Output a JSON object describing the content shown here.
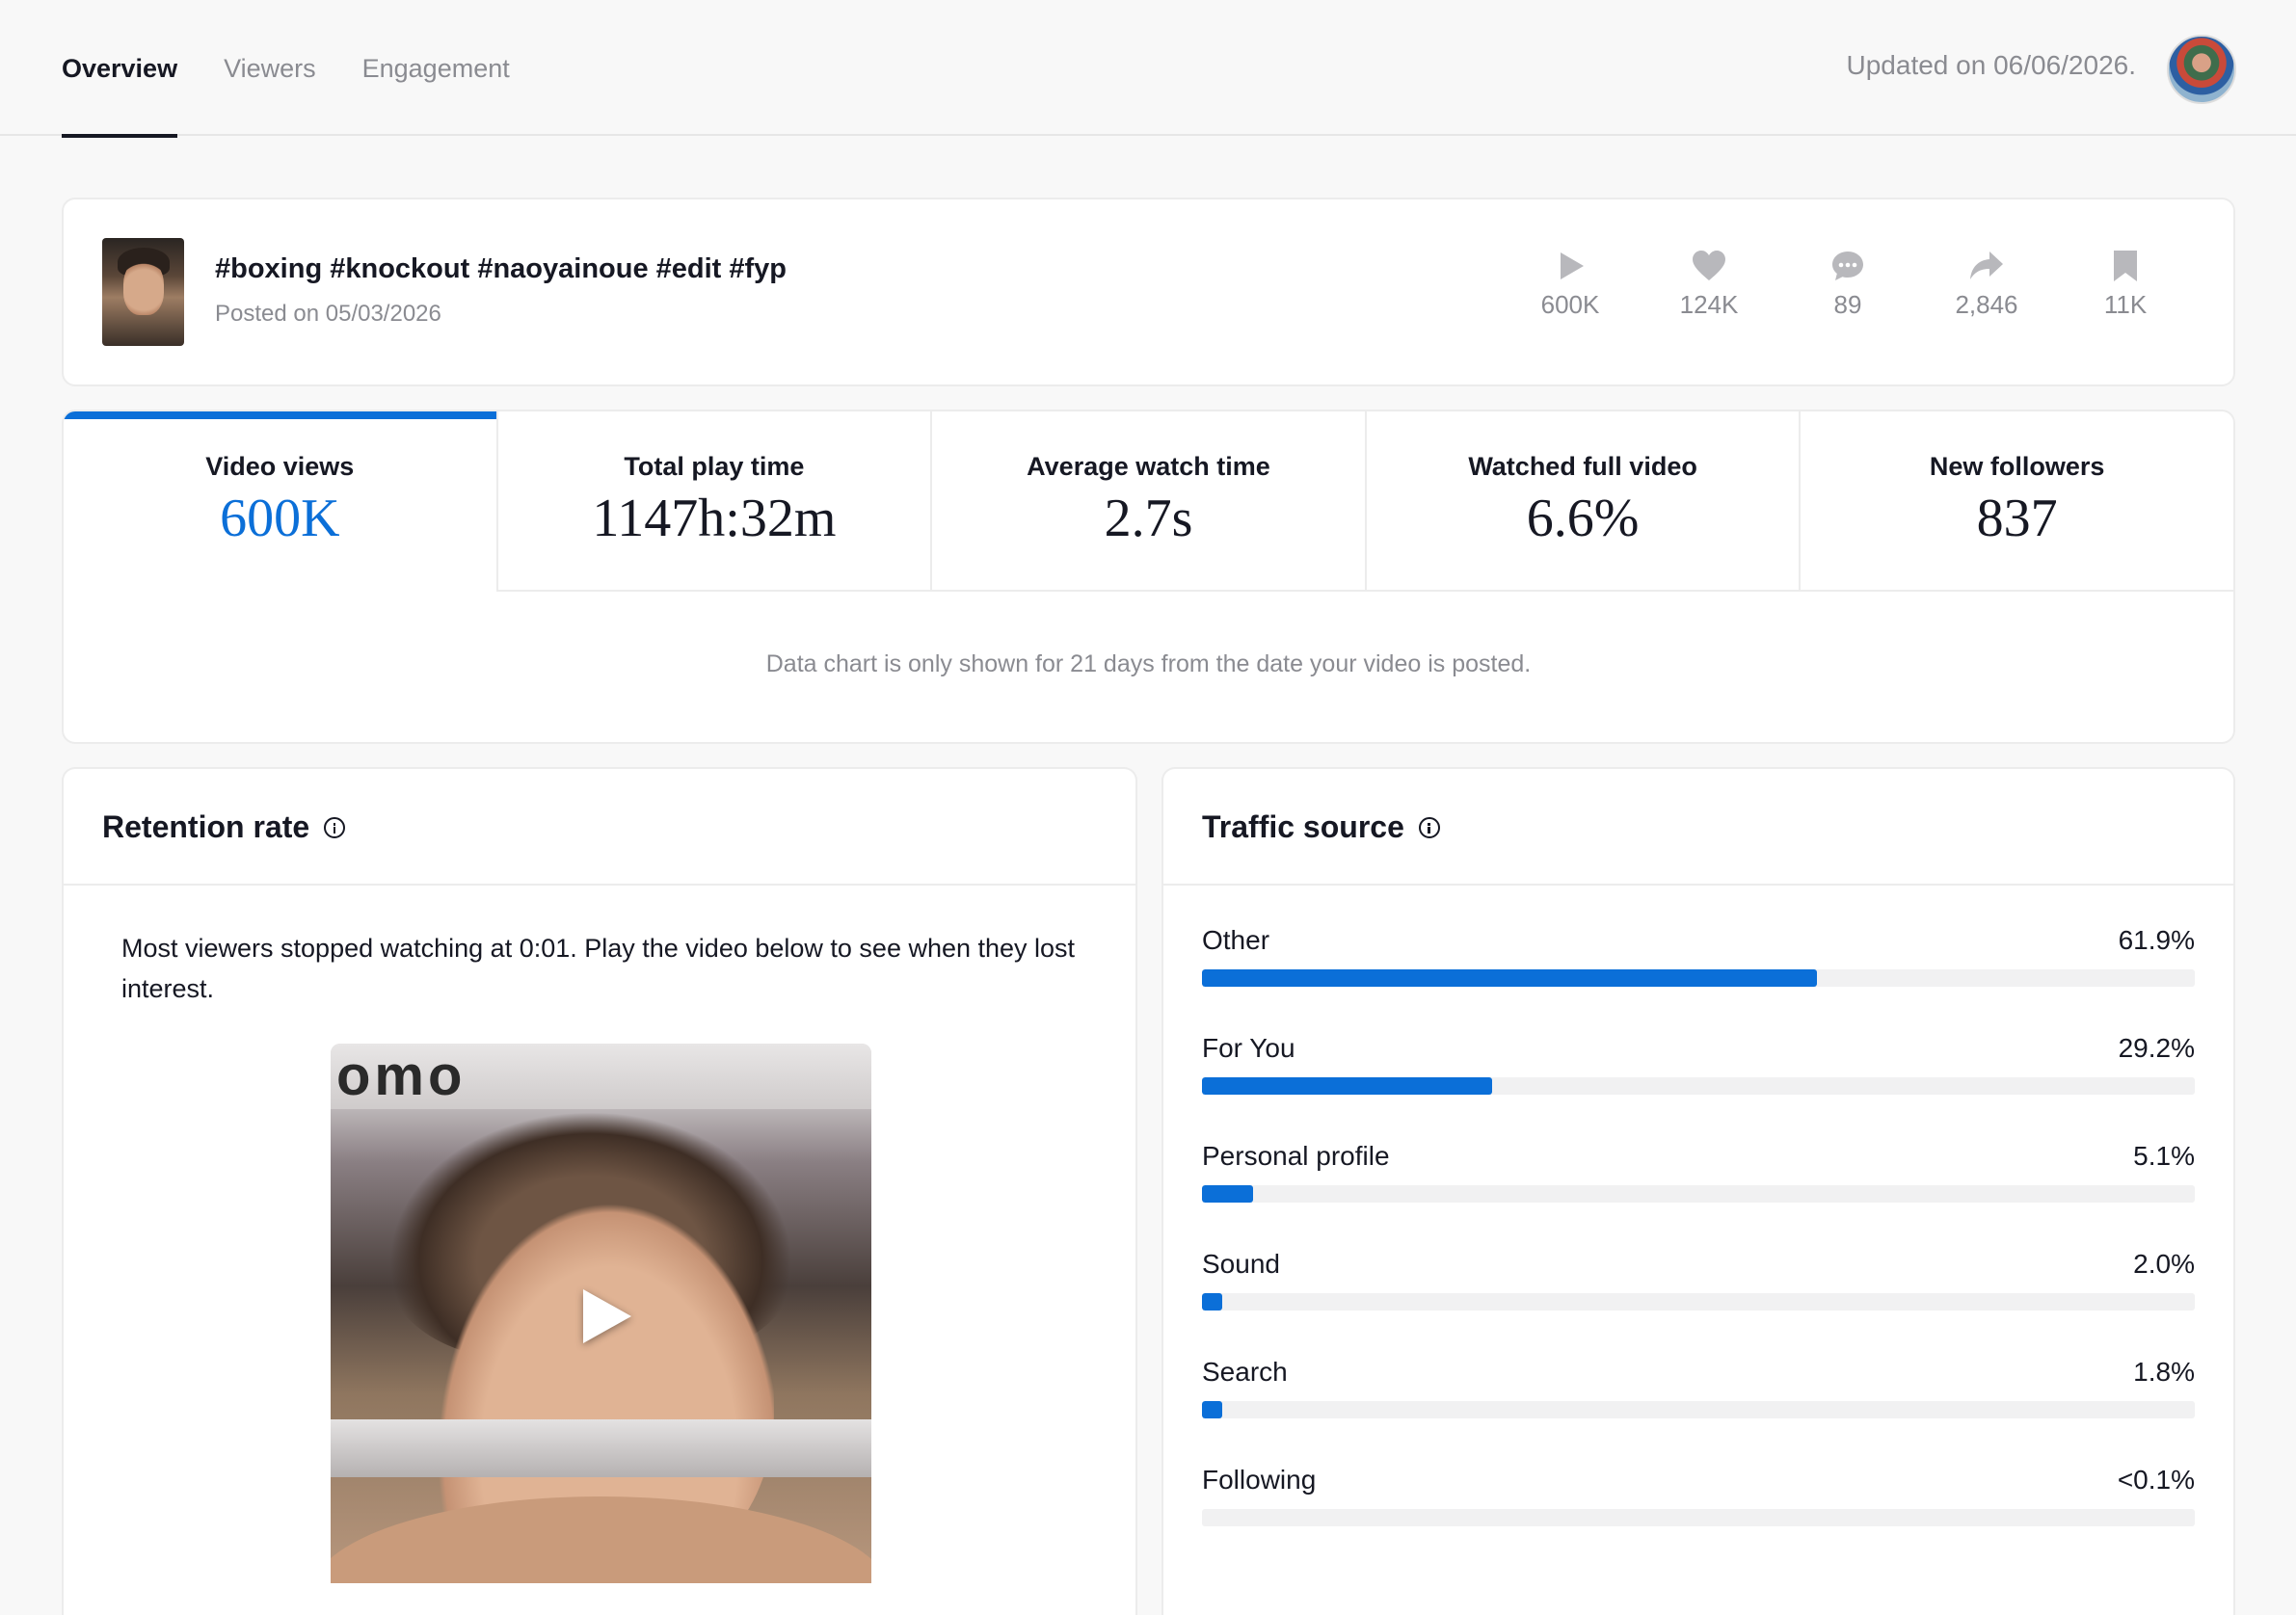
{
  "tabs": [
    "Overview",
    "Viewers",
    "Engagement"
  ],
  "updated_text": "Updated on 06/06/2026.",
  "post": {
    "title": "#boxing #knockout #naoyainoue #edit #fyp",
    "posted": "Posted on 05/03/2026",
    "stats": {
      "views": "600K",
      "likes": "124K",
      "comments": "89",
      "shares": "2,846",
      "saves": "11K"
    }
  },
  "metrics": [
    {
      "label": "Video views",
      "value": "600K"
    },
    {
      "label": "Total play time",
      "value": "1147h:32m"
    },
    {
      "label": "Average watch time",
      "value": "2.7s"
    },
    {
      "label": "Watched full video",
      "value": "6.6%"
    },
    {
      "label": "New followers",
      "value": "837"
    }
  ],
  "chart_note": "Data chart is only shown for 21 days from the date your video is posted.",
  "retention": {
    "title": "Retention rate",
    "text": "Most viewers stopped watching at 0:01. Play the video below to see when they lost interest.",
    "video_banner": "omo"
  },
  "traffic": {
    "title": "Traffic source",
    "sources": [
      {
        "name": "Other",
        "pct": "61.9%",
        "value": 61.9
      },
      {
        "name": "For You",
        "pct": "29.2%",
        "value": 29.2
      },
      {
        "name": "Personal profile",
        "pct": "5.1%",
        "value": 5.1
      },
      {
        "name": "Sound",
        "pct": "2.0%",
        "value": 2.0
      },
      {
        "name": "Search",
        "pct": "1.8%",
        "value": 1.8
      },
      {
        "name": "Following",
        "pct": "<0.1%",
        "value": 0.05
      }
    ]
  },
  "colors": {
    "accent": "#0b6fd8",
    "text": "#161823",
    "muted": "#8a8b91"
  }
}
